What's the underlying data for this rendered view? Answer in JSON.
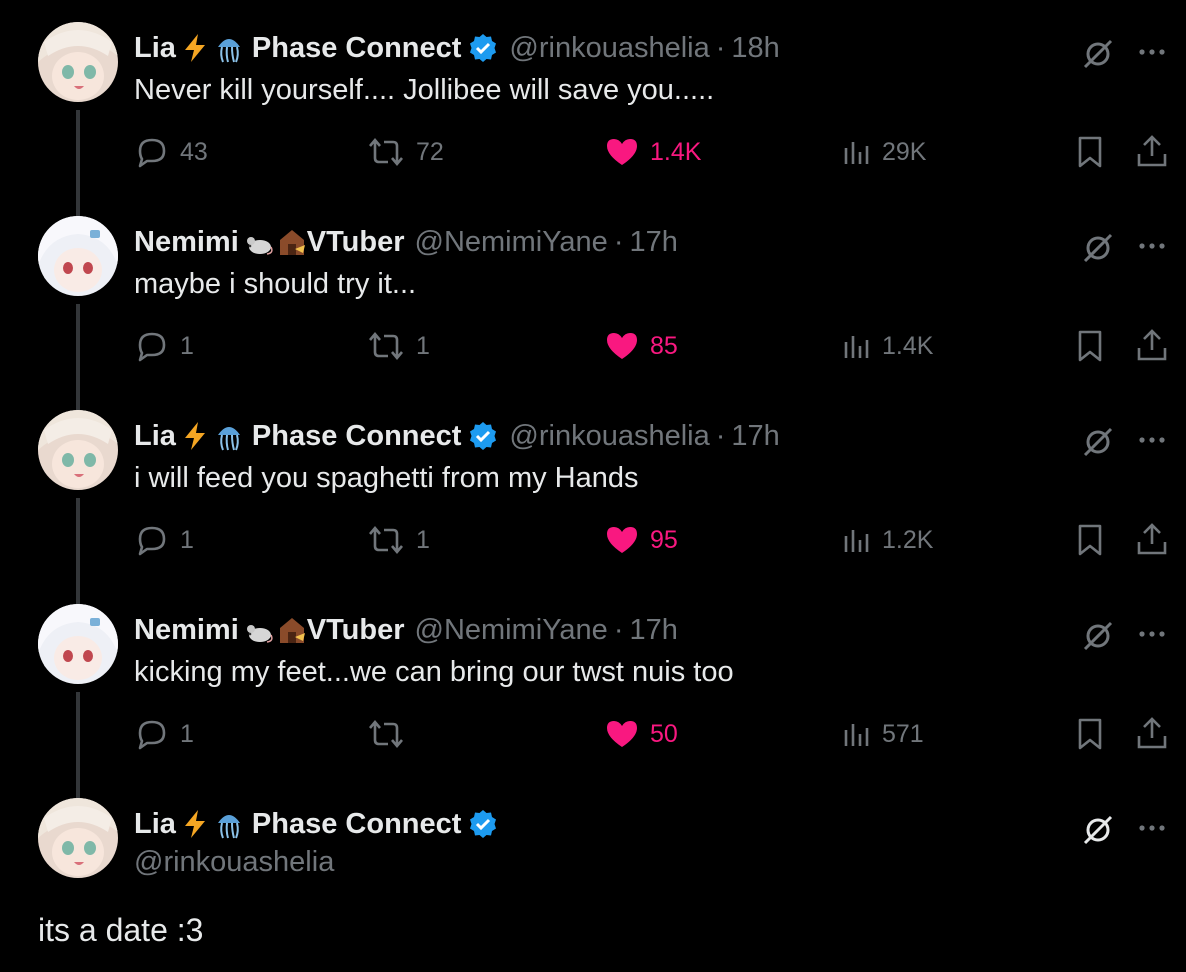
{
  "thread": [
    {
      "name": "Lia",
      "name_suffix": "Phase Connect",
      "emojis": [
        "lightning-emoji",
        "jellyfish-emoji"
      ],
      "verified": true,
      "handle": "@rinkouashelia",
      "separator": "·",
      "time": "18h",
      "text": "Never kill yourself.... Jollibee will save you.....",
      "replies": "43",
      "reposts": "72",
      "likes": "1.4K",
      "views": "29K"
    },
    {
      "name": "Nemimi",
      "name_suffix": "VTuber",
      "emojis": [
        "mouse-emoji",
        "house-emoji"
      ],
      "verified": false,
      "handle": "@NemimiYane",
      "separator": "·",
      "time": "17h",
      "text": "maybe i should try it...",
      "replies": "1",
      "reposts": "1",
      "likes": "85",
      "views": "1.4K"
    },
    {
      "name": "Lia",
      "name_suffix": "Phase Connect",
      "emojis": [
        "lightning-emoji",
        "jellyfish-emoji"
      ],
      "verified": true,
      "handle": "@rinkouashelia",
      "separator": "·",
      "time": "17h",
      "text": "i will feed you spaghetti from my Hands",
      "replies": "1",
      "reposts": "1",
      "likes": "95",
      "views": "1.2K"
    },
    {
      "name": "Nemimi",
      "name_suffix": "VTuber",
      "emojis": [
        "mouse-emoji",
        "house-emoji"
      ],
      "verified": false,
      "handle": "@NemimiYane",
      "separator": "·",
      "time": "17h",
      "text": "kicking my feet...we can bring our twst nuis too",
      "replies": "1",
      "reposts": "",
      "likes": "50",
      "views": "571"
    }
  ],
  "main_tweet": {
    "name": "Lia",
    "name_suffix": "Phase Connect",
    "verified": true,
    "handle": "@rinkouashelia",
    "text": "its a date :3"
  },
  "colors": {
    "background": "#000000",
    "text": "#e7e9ea",
    "muted": "#71767b",
    "like": "#f91880",
    "verified": "#1d9bf0",
    "thread_line": "#333639"
  }
}
